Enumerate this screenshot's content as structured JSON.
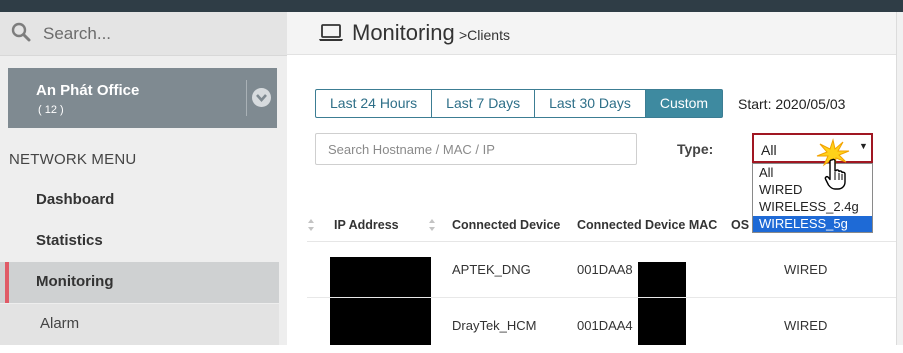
{
  "sidebar": {
    "search_placeholder": "Search...",
    "site": {
      "name": "An Phát Office",
      "count": "( 12 )"
    },
    "menu_heading": "NETWORK MENU",
    "items": [
      {
        "label": "Dashboard"
      },
      {
        "label": "Statistics"
      },
      {
        "label": "Monitoring",
        "active": true
      },
      {
        "label": "Alarm"
      }
    ]
  },
  "header": {
    "title": "Monitoring",
    "breadcrumb": ">Clients",
    "icon": "laptop-icon"
  },
  "time_range": {
    "buttons": [
      "Last 24 Hours",
      "Last 7 Days",
      "Last 30 Days",
      "Custom"
    ],
    "active": "Custom",
    "start_text": "Start: 2020/05/03"
  },
  "filters": {
    "search_placeholder": "Search Hostname / MAC / IP",
    "type_label": "Type:",
    "type_value": "All",
    "type_options": [
      "All",
      "WIRED",
      "WIRELESS_2.4g",
      "WIRELESS_5g"
    ],
    "highlighted_option": "WIRELESS_5g"
  },
  "table": {
    "columns": [
      "IP Address",
      "Connected Device",
      "Connected Device MAC",
      "OS"
    ],
    "rows": [
      {
        "ip": "",
        "device": "APTEK_DNG",
        "mac": "001DAA8",
        "type": "WIRED"
      },
      {
        "ip": "",
        "device": "DrayTek_HCM",
        "mac": "001DAA4",
        "type": "WIRED"
      }
    ]
  },
  "colors": {
    "accent": "#3e8aa0",
    "active_marker": "#e05a66",
    "select_border": "#a01722",
    "highlight": "#1e6ad6"
  }
}
